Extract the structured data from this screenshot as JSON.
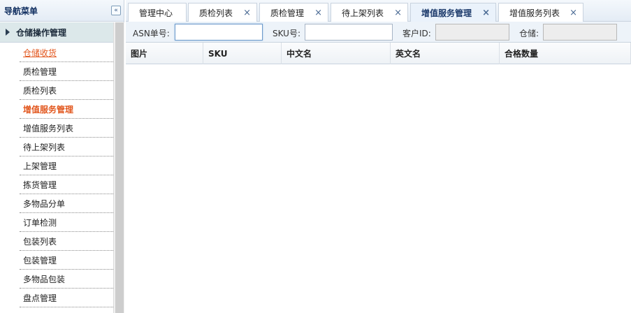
{
  "sidebar": {
    "title": "导航菜单",
    "collapse_icon": "«",
    "group": {
      "label": "仓储操作管理"
    },
    "items": [
      {
        "label": "仓储收货",
        "state": "active"
      },
      {
        "label": "质检管理",
        "state": ""
      },
      {
        "label": "质检列表",
        "state": ""
      },
      {
        "label": "增值服务管理",
        "state": "current"
      },
      {
        "label": "增值服务列表",
        "state": ""
      },
      {
        "label": "待上架列表",
        "state": ""
      },
      {
        "label": "上架管理",
        "state": ""
      },
      {
        "label": "拣货管理",
        "state": ""
      },
      {
        "label": "多物品分单",
        "state": ""
      },
      {
        "label": "订单检测",
        "state": ""
      },
      {
        "label": "包装列表",
        "state": ""
      },
      {
        "label": "包装管理",
        "state": ""
      },
      {
        "label": "多物品包装",
        "state": ""
      },
      {
        "label": "盘点管理",
        "state": ""
      }
    ]
  },
  "tabs": [
    {
      "label": "管理中心",
      "closable": false,
      "active": false
    },
    {
      "label": "质检列表",
      "closable": true,
      "active": false
    },
    {
      "label": "质检管理",
      "closable": true,
      "active": false
    },
    {
      "label": "待上架列表",
      "closable": true,
      "active": false
    },
    {
      "label": "增值服务管理",
      "closable": true,
      "active": true
    },
    {
      "label": "增值服务列表",
      "closable": true,
      "active": false
    }
  ],
  "tab_close_glyph": "×",
  "filters": {
    "asn_label": "ASN单号:",
    "asn_value": "",
    "sku_label": "SKU号:",
    "sku_value": "",
    "customer_label": "客户ID:",
    "customer_value": "",
    "warehouse_label": "仓储:",
    "warehouse_value": ""
  },
  "grid": {
    "columns": [
      "图片",
      "SKU",
      "中文名",
      "英文名",
      "合格数量"
    ],
    "rows": []
  },
  "colors": {
    "accent_orange": "#e2571e",
    "header_bg": "#e4ecf5",
    "group_bg": "#dce8ea",
    "active_tab_text": "#1c3a6b"
  }
}
